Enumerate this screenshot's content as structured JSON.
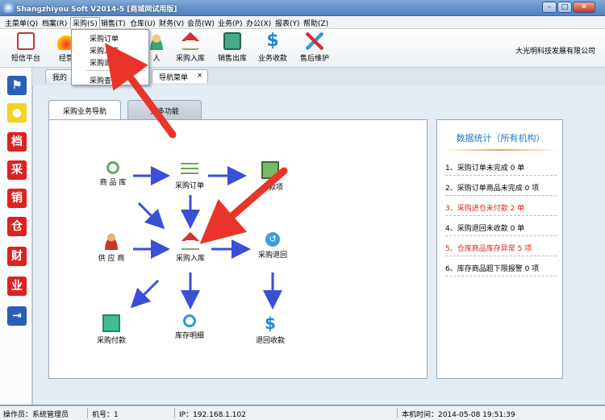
{
  "window": {
    "title": "Shangzhiyou Soft V2014-5 [商城网试用版]"
  },
  "menubar": {
    "items": [
      "主菜单(Q)",
      "档案(R)",
      "采购(S)",
      "销售(T)",
      "仓库(U)",
      "财务(V)",
      "会员(W)",
      "业务(P)",
      "办公(X)",
      "报表(Y)",
      "帮助(Z)"
    ]
  },
  "toolbar": {
    "buttons": [
      "短信平台",
      "经营",
      "人",
      "采购入库",
      "销售出库",
      "业务收款",
      "售后维护"
    ],
    "company": "大光明科技发展有限公司"
  },
  "dropdown": {
    "items": [
      "采购订单",
      "采购入库",
      "采购退回",
      "采购查询"
    ]
  },
  "tabs": {
    "home": "我的",
    "nav": "导航菜单",
    "close": "✕"
  },
  "sidebar": {
    "glyphs": [
      "档",
      "采",
      "销",
      "仓",
      "财",
      "业"
    ]
  },
  "subtabs": {
    "active": "采购业务导航",
    "other": "更多功能"
  },
  "flow": {
    "nodes": [
      "商 品 库",
      "采购订单",
      "款项",
      "供 应 商",
      "采购入库",
      "采购退回",
      "采购付款",
      "库存明细",
      "退回收款"
    ]
  },
  "stats": {
    "title": "数据统计（所有机构）",
    "items": [
      {
        "text": "1、采购订单未完成 0 单",
        "color": "#000000"
      },
      {
        "text": "2、采购订单商品未完成 0 项",
        "color": "#000000"
      },
      {
        "text": "3、采购进仓未付款 2 单",
        "color": "#e02020"
      },
      {
        "text": "4、采购退回未收款 0 单",
        "color": "#000000"
      },
      {
        "text": "5、仓库商品库存异常 5 项",
        "color": "#e02020"
      },
      {
        "text": "6、库存商品超下限报警 0 项",
        "color": "#000000"
      }
    ]
  },
  "statusbar": {
    "operator": "操作员：系统管理员",
    "machine": "机号：1",
    "ip": "IP：192.168.1.102",
    "time": "本机时间：2014-05-08 19:51:39"
  },
  "colors": {
    "arrow_red": "#e8342a",
    "flow_blue": "#3a4fd6",
    "accent": "#2277cc"
  }
}
